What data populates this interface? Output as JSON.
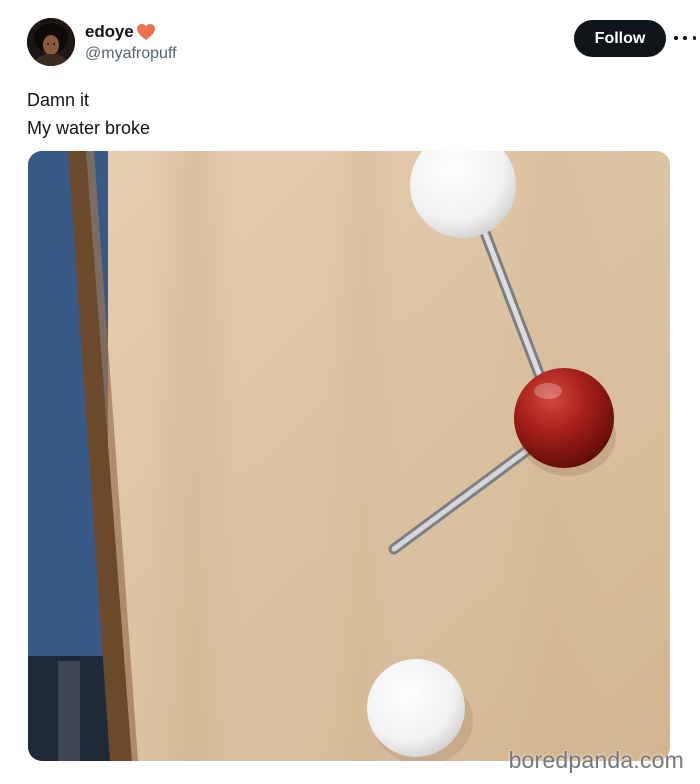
{
  "author": {
    "display_name": "edoye",
    "handle": "@myafropuff",
    "name_emoji_icon": "orange-heart-icon"
  },
  "actions": {
    "follow_label": "Follow",
    "more_icon": "more-horizontal-icon"
  },
  "tweet": {
    "lines": [
      "Damn it",
      "My water broke"
    ]
  },
  "media": {
    "subject": "molecular model photo"
  },
  "watermark": "boredpanda.com",
  "colors": {
    "follow_bg": "#0f1419",
    "text_primary": "#0f1419",
    "text_secondary": "#536471",
    "heart": "#e8734a"
  }
}
